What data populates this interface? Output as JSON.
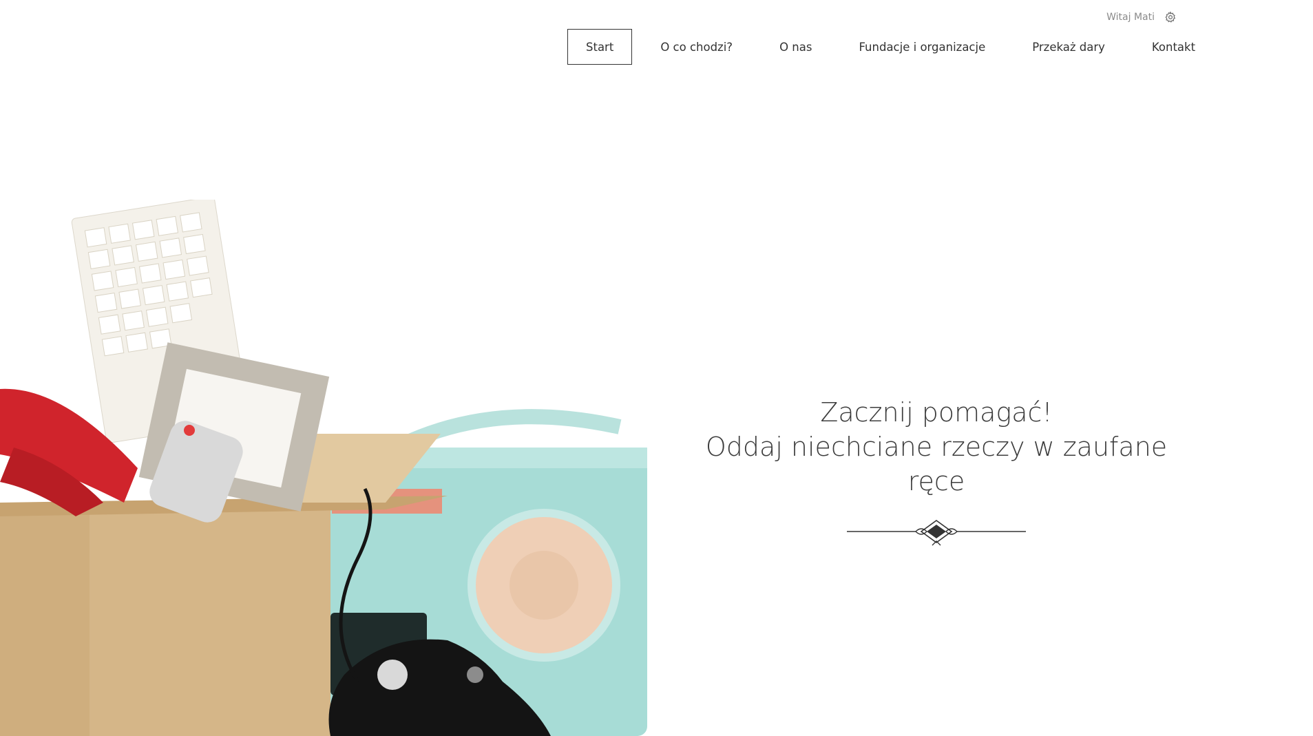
{
  "header": {
    "greeting": "Witaj Mati",
    "settings_icon": "gear-icon",
    "nav": [
      {
        "label": "Start",
        "active": true
      },
      {
        "label": "O co chodzi?",
        "active": false
      },
      {
        "label": "O nas",
        "active": false
      },
      {
        "label": "Fundacje i organizacje",
        "active": false
      },
      {
        "label": "Przekaż dary",
        "active": false
      },
      {
        "label": "Kontakt",
        "active": false
      }
    ]
  },
  "hero": {
    "line1": "Zacznij pomagać!",
    "line2": "Oddaj niechciane rzeczy w zaufane ręce",
    "decoration_icon": "ornament-divider-icon",
    "image_icon": "donation-box-illustration"
  },
  "colors": {
    "text": "#333333",
    "box": "#cfae7e",
    "radio": "#a7dcd6",
    "phone": "#d0242c"
  }
}
